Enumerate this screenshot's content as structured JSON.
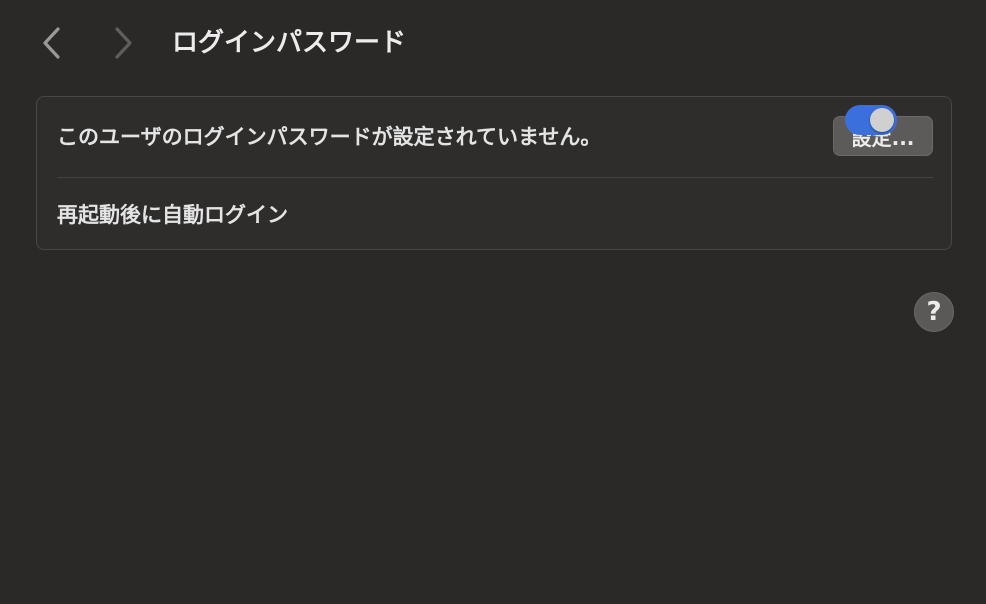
{
  "toolbar": {
    "back_icon": "chevron-left-icon",
    "forward_icon": "chevron-right-icon",
    "title": "ログインパスワード"
  },
  "settings_group": {
    "password_row": {
      "label": "このユーザのログインパスワードが設定されていません。",
      "button_label": "設定..."
    },
    "autologin_row": {
      "label": "再起動後に自動ログイン",
      "toggle_on": true
    }
  },
  "help": {
    "label": "?",
    "icon": "question-mark-icon"
  },
  "colors": {
    "background": "#2a2928",
    "accent": "#3b6fdc"
  }
}
